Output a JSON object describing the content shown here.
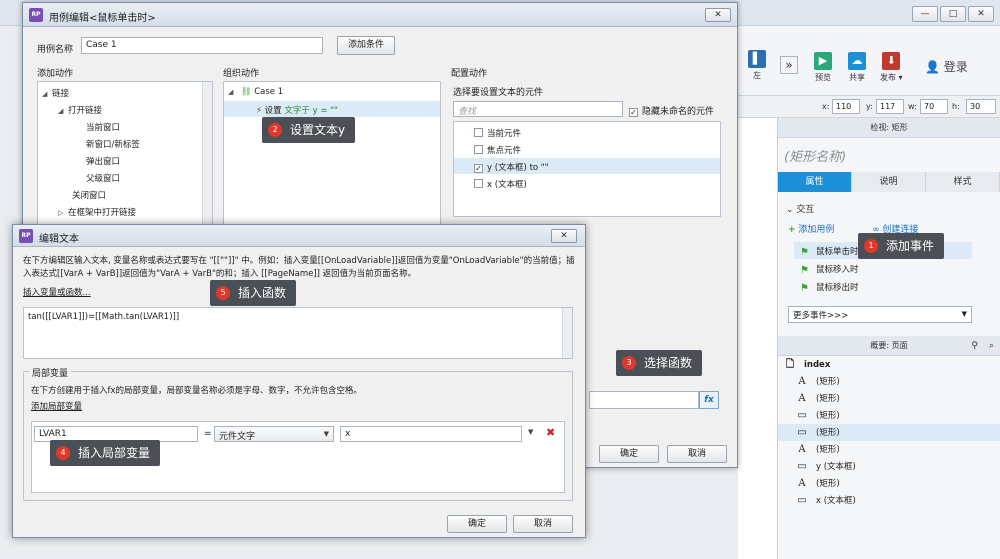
{
  "app": {
    "titlebar_buttons": [
      "—",
      "□",
      "✕"
    ],
    "toolbar": {
      "left_label": "左",
      "expand_label": "»",
      "preview_label": "预览",
      "share_label": "共享",
      "publish_label": "发布 ▾",
      "login_label": "登录"
    },
    "format": {
      "x_label": "x:",
      "x_value": "110",
      "y_label": "y:",
      "y_value": "117",
      "w_label": "w:",
      "w_value": "70",
      "h_label": "h:",
      "h_value": "30"
    },
    "inspector": {
      "header": "检视: 矩形",
      "shape_name_placeholder": "(矩形名称)",
      "tabs": [
        "属性",
        "说明",
        "样式"
      ],
      "interaction_label": "交互",
      "add_case_link": "添加用例",
      "create_link": "创建连接",
      "events": [
        "鼠标单击时",
        "鼠标移入时",
        "鼠标移出时"
      ],
      "more_events": "更多事件>>>"
    },
    "outline": {
      "header": "概要: 页面",
      "page": "index",
      "items": [
        {
          "icon": "A",
          "label": "(矩形)"
        },
        {
          "icon": "A",
          "label": "(矩形)"
        },
        {
          "icon": "▭",
          "label": "(矩形)"
        },
        {
          "icon": "▭",
          "label": "(矩形)"
        },
        {
          "icon": "A",
          "label": "(矩形)"
        },
        {
          "icon": "▭",
          "label": "y (文本框)"
        },
        {
          "icon": "A",
          "label": "(矩形)"
        },
        {
          "icon": "▭",
          "label": "x (文本框)"
        }
      ]
    }
  },
  "case_dialog": {
    "title": "用例编辑<鼠标单击时>",
    "close_label": "✕",
    "case_name_label": "用例名称",
    "case_name_value": "Case 1",
    "add_condition_label": "添加条件",
    "add_action_header": "添加动作",
    "organize_header": "组织动作",
    "configure_header": "配置动作",
    "add_actions": [
      {
        "label": "链接",
        "level": 0,
        "tri": "◢"
      },
      {
        "label": "打开链接",
        "level": 1,
        "tri": "◢"
      },
      {
        "label": "当前窗口",
        "level": 2,
        "tri": ""
      },
      {
        "label": "新窗口/新标签",
        "level": 2,
        "tri": ""
      },
      {
        "label": "弹出窗口",
        "level": 2,
        "tri": ""
      },
      {
        "label": "父级窗口",
        "level": 2,
        "tri": ""
      },
      {
        "label": "关闭窗口",
        "level": 1,
        "tri": ""
      },
      {
        "label": "在框架中打开链接",
        "level": 1,
        "tri": "▷"
      }
    ],
    "organize": {
      "case_label": "Case 1",
      "action_prefix": "设置",
      "action_text": "文字于 y = \"\""
    },
    "configure": {
      "select_label": "选择要设置文本的元件",
      "search_placeholder": "查找",
      "hide_unnamed_label": "隐藏未命名的元件",
      "widgets": [
        {
          "label": "当前元件",
          "checked": false
        },
        {
          "label": "焦点元件",
          "checked": false
        },
        {
          "label": "y (文本框) to \"\"",
          "checked": true
        },
        {
          "label": "x (文本框)",
          "checked": false
        }
      ],
      "fx_label": "fx"
    },
    "ok_label": "确定",
    "cancel_label": "取消"
  },
  "text_dialog": {
    "title": "编辑文本",
    "close_label": "✕",
    "description": "在下方编辑区输入文本, 变量名称或表达式要写在 \"[[\"\"]]\" 中。例如：插入变量[[OnLoadVariable]]返回值为变量\"OnLoadVariable\"的当前值；插入表达式[[VarA + VarB]]返回值为\"VarA + VarB\"的和；插入 [[PageName]] 返回值为当前页面名称。",
    "insert_link": "插入变量或函数...",
    "editor_value": "tan([[LVAR1]])=[[Math.tan(LVAR1)]]",
    "local_vars_title": "局部变量",
    "local_vars_desc": "在下方创建用于插入fx的局部变量，局部变量名称必须是字母、数字，不允许包含空格。",
    "add_local_var_link": "添加局部变量",
    "var_row": {
      "name": "LVAR1",
      "equals": "=",
      "type": "元件文字",
      "target": "x",
      "delete": "✖"
    },
    "ok_label": "确定",
    "cancel_label": "取消"
  },
  "callouts": [
    {
      "num": "1",
      "text": "添加事件"
    },
    {
      "num": "2",
      "text": "设置文本y"
    },
    {
      "num": "3",
      "text": "选择函数"
    },
    {
      "num": "4",
      "text": "插入局部变量"
    },
    {
      "num": "5",
      "text": "插入函数"
    }
  ]
}
